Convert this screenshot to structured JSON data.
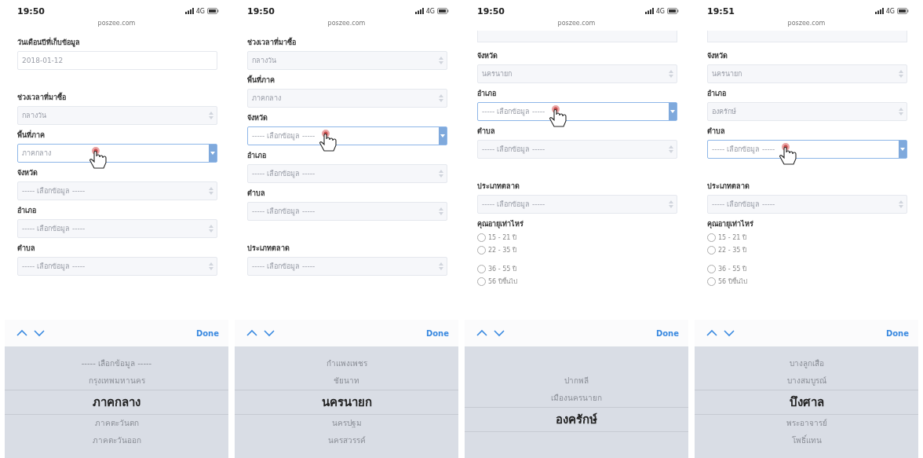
{
  "phones": [
    {
      "time": "19:50",
      "network": "4G",
      "url": "poszee.com",
      "items": [
        {
          "kind": "input",
          "label": "วันเดือนปีที่เก็บข้อมูล",
          "value": "2018-01-12",
          "focused": false
        },
        {
          "kind": "spacer"
        },
        {
          "kind": "select",
          "label": "ช่วงเวลาที่มาซื้อ",
          "value": "กลางวัน",
          "focused": false
        },
        {
          "kind": "select",
          "label": "พื้นที่ภาค",
          "value": "ภาคกลาง",
          "focused": true
        },
        {
          "kind": "select",
          "label": "จังหวัด",
          "value": "----- เลือกข้อมูล -----",
          "focused": false
        },
        {
          "kind": "select",
          "label": "อำเภอ",
          "value": "----- เลือกข้อมูล -----",
          "focused": false
        },
        {
          "kind": "select",
          "label": "ตำบล",
          "value": "----- เลือกข้อมูล -----",
          "focused": false
        }
      ],
      "done": "Done",
      "picker": [
        {
          "text": "----- เลือกข้อมูล -----",
          "selected": false
        },
        {
          "text": "กรุงเทพมหานคร",
          "selected": false
        },
        {
          "text": "ภาคกลาง",
          "selected": true
        },
        {
          "text": "ภาคตะวันตก",
          "selected": false
        },
        {
          "text": "ภาคตะวันออก",
          "selected": false
        }
      ]
    },
    {
      "time": "19:50",
      "network": "4G",
      "url": "poszee.com",
      "items": [
        {
          "kind": "select",
          "label": "ช่วงเวลาที่มาซื้อ",
          "value": "กลางวัน",
          "focused": false
        },
        {
          "kind": "select",
          "label": "พื้นที่ภาค",
          "value": "ภาคกลาง",
          "focused": false
        },
        {
          "kind": "select",
          "label": "จังหวัด",
          "value": "----- เลือกข้อมูล -----",
          "focused": true
        },
        {
          "kind": "select",
          "label": "อำเภอ",
          "value": "----- เลือกข้อมูล -----",
          "focused": false
        },
        {
          "kind": "select",
          "label": "ตำบล",
          "value": "----- เลือกข้อมูล -----",
          "focused": false
        },
        {
          "kind": "spacer"
        },
        {
          "kind": "select",
          "label": "ประเภทตลาด",
          "value": "----- เลือกข้อมูล -----",
          "focused": false
        }
      ],
      "done": "Done",
      "picker": [
        {
          "text": "กำแพงเพชร",
          "selected": false
        },
        {
          "text": "ชัยนาท",
          "selected": false
        },
        {
          "text": "นครนายก",
          "selected": true
        },
        {
          "text": "นครปฐม",
          "selected": false
        },
        {
          "text": "นครสวรรค์",
          "selected": false
        }
      ]
    },
    {
      "time": "19:50",
      "network": "4G",
      "url": "poszee.com",
      "items": [
        {
          "kind": "cut"
        },
        {
          "kind": "select",
          "label": "จังหวัด",
          "value": "นครนายก",
          "focused": false
        },
        {
          "kind": "select",
          "label": "อำเภอ",
          "value": "----- เลือกข้อมูล -----",
          "focused": true
        },
        {
          "kind": "select",
          "label": "ตำบล",
          "value": "----- เลือกข้อมูล -----",
          "focused": false
        },
        {
          "kind": "spacer"
        },
        {
          "kind": "select",
          "label": "ประเภทตลาด",
          "value": "----- เลือกข้อมูล -----",
          "focused": false
        },
        {
          "kind": "radios",
          "label": "คุณอายุเท่าไหร่",
          "options": [
            {
              "text": "15 - 21 ปี",
              "selected": false
            },
            {
              "text": "22 - 35 ปี",
              "selected": false
            },
            {
              "text": "36 - 55 ปี",
              "selected": false
            },
            {
              "text": "56 ปีขึ้นไป",
              "selected": false
            }
          ]
        }
      ],
      "done": "Done",
      "picker": [
        {
          "text": "ปากพลี",
          "selected": false
        },
        {
          "text": "เมืองนครนายก",
          "selected": false
        },
        {
          "text": "องครักษ์",
          "selected": true
        }
      ]
    },
    {
      "time": "19:51",
      "network": "4G",
      "url": "poszee.com",
      "items": [
        {
          "kind": "cut"
        },
        {
          "kind": "select",
          "label": "จังหวัด",
          "value": "นครนายก",
          "focused": false
        },
        {
          "kind": "select",
          "label": "อำเภอ",
          "value": "องครักษ์",
          "focused": false
        },
        {
          "kind": "select",
          "label": "ตำบล",
          "value": "----- เลือกข้อมูล -----",
          "focused": true
        },
        {
          "kind": "spacer"
        },
        {
          "kind": "select",
          "label": "ประเภทตลาด",
          "value": "----- เลือกข้อมูล -----",
          "focused": false
        },
        {
          "kind": "radios",
          "label": "คุณอายุเท่าไหร่",
          "options": [
            {
              "text": "15 - 21 ปี",
              "selected": false
            },
            {
              "text": "22 - 35 ปี",
              "selected": false
            },
            {
              "text": "36 - 55 ปี",
              "selected": false
            },
            {
              "text": "56 ปีขึ้นไป",
              "selected": false
            }
          ]
        }
      ],
      "done": "Done",
      "picker": [
        {
          "text": "บางลูกเสือ",
          "selected": false
        },
        {
          "text": "บางสมบูรณ์",
          "selected": false
        },
        {
          "text": "บึงศาล",
          "selected": true
        },
        {
          "text": "พระอาจารย์",
          "selected": false
        },
        {
          "text": "โพธิ์แทน",
          "selected": false
        }
      ]
    }
  ]
}
